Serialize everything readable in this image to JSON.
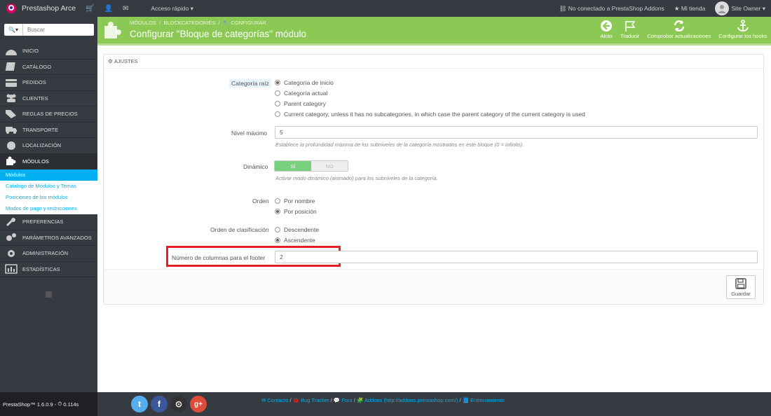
{
  "topbar": {
    "shop_name": "Prestashop Arce",
    "quick_access": "Acceso rápido",
    "addons_status": "No conectado a PrestaShop Addons",
    "my_shop": "Mi tienda",
    "user": "Site Owner"
  },
  "sidebar": {
    "search_placeholder": "Buscar",
    "items": [
      {
        "label": "INICIO",
        "icon": "dashboard-icon"
      },
      {
        "label": "CATÁLOGO",
        "icon": "book-icon"
      },
      {
        "label": "PEDIDOS",
        "icon": "credit-card-icon"
      },
      {
        "label": "CLIENTES",
        "icon": "users-icon"
      },
      {
        "label": "REGLAS DE PRECIOS",
        "icon": "tags-icon"
      },
      {
        "label": "TRANSPORTE",
        "icon": "truck-icon"
      },
      {
        "label": "LOCALIZACIÓN",
        "icon": "globe-icon"
      },
      {
        "label": "MÓDULOS",
        "icon": "puzzle-icon"
      }
    ],
    "submenu": [
      "Módulos",
      "Catalogo de Módulos y Temas",
      "Posiciones de los módulos",
      "Modos de pago y restricciones"
    ],
    "items_after": [
      {
        "label": "PREFERENCIAS",
        "icon": "wrench-icon"
      },
      {
        "label": "PARÁMETROS AVANZADOS",
        "icon": "cogs-icon"
      },
      {
        "label": "ADMINISTRACIÓN",
        "icon": "cog-icon"
      },
      {
        "label": "ESTADÍSTICAS",
        "icon": "bar-chart-icon"
      }
    ],
    "version": "PrestaShop™ 1.6.0.9 - ",
    "timing": "0.114s"
  },
  "toolbar": {
    "breadcrumb_1": "MÓDULOS",
    "breadcrumb_2": "BLOCKCATEGORIES",
    "breadcrumb_3": "CONFIGURAR",
    "title": "Configurar \"Bloque de categorías\" módulo",
    "actions": [
      "Atrás",
      "Traducir",
      "Comprobar actualizaciones",
      "Configurar los hooks"
    ]
  },
  "panel": {
    "heading": "AJUSTES",
    "root_label": "Categoría raíz",
    "root_options": [
      "Categoría de inicio",
      "Categoría actual",
      "Parent category",
      "Current category, unless it has no subcategories, in which case the parent category of the current category is used"
    ],
    "max_level_label": "Nivel máximo",
    "max_level_value": "5",
    "max_level_help": "Establece la profundidad máxima de los subniveles de la categoría mostrados en este bloque (0 = infinito).",
    "dynamic_label": "Dinámico",
    "dynamic_yes": "SÍ",
    "dynamic_no": "NO",
    "dynamic_help": "Activar modo dinámico (animado) para los subniveles de la categoría.",
    "order_label": "Orden",
    "order_options": [
      "Por nombre",
      "Por posición"
    ],
    "sort_label": "Orden de clasificación",
    "sort_options": [
      "Descendente",
      "Ascendente"
    ],
    "columns_label": "Número de columnas para el footer",
    "columns_value": "2",
    "save_label": "Guardar"
  },
  "footer": {
    "links": [
      "Contacto",
      "Bug Tracker",
      "Foro",
      "Addons (http://addons.prestashop.com/)",
      "Entrenamiento"
    ],
    "separator": " / "
  }
}
